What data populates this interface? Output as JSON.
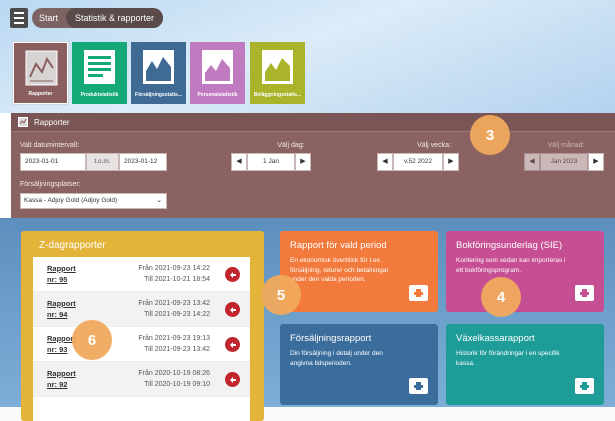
{
  "topbar": {
    "start": "Start",
    "current": "Statistik & rapporter"
  },
  "tiles": [
    {
      "label": "Rapporter",
      "color": "#8a5e5e"
    },
    {
      "label": "Produktstatistik",
      "color": "#15a878"
    },
    {
      "label": "Försäljningsstatis...",
      "color": "#3e6a94"
    },
    {
      "label": "Personalstatistik",
      "color": "#c07ac0"
    },
    {
      "label": "Beläggningsstatis...",
      "color": "#aab42a"
    }
  ],
  "panel": {
    "title": "Rapporter",
    "date_interval_label": "Valt datumintervall:",
    "date_from": "2023-01-01",
    "tom": "t.o.m.",
    "date_to": "2023-01-12",
    "day_label": "Välj dag:",
    "day_value": "1 Jan",
    "week_label": "Välj vecka:",
    "week_value": "v.52 2022",
    "month_label": "Välj månad:",
    "month_value": "Jan 2023",
    "sales_points_label": "Försäljningsplatser:",
    "sales_point_value": "Kassa - Adjoy Gold (Adjoy Gold)"
  },
  "zdag": {
    "title": "Z-dagrapporter",
    "rows": [
      {
        "name": "Rapport",
        "nr": "nr: 95",
        "from": "Från 2021-09-23 14:22",
        "to": "Till 2021-10-21 18:54"
      },
      {
        "name": "Rapport",
        "nr": "nr: 94",
        "from": "Från 2021-09-23 13:42",
        "to": "Till 2021-09-23 14:22"
      },
      {
        "name": "Rapport",
        "nr": "nr: 93",
        "from": "Från 2021-09-23 19:13",
        "to": "Till 2021-09-23 13:42"
      },
      {
        "name": "Rapport",
        "nr": "nr: 92",
        "from": "Från 2020-10-19 08:26",
        "to": "Till 2020-10-19 09:10"
      }
    ]
  },
  "cards": [
    {
      "title": "Rapport för vald period",
      "desc": "En ekonomisk överblick för t.ex. försäljning, returer och betalningar under den valda perioden.",
      "color": "#f27a3c"
    },
    {
      "title": "Bokföringsunderlag (SIE)",
      "desc": "Kontering som sedan kan importeras i ett bokföringsprogram.",
      "color": "#c64f93"
    },
    {
      "title": "Försäljningsrapport",
      "desc": "Din försäljning i detalj under den angivna tidsperioden.",
      "color": "#3b6d9c"
    },
    {
      "title": "Växelkassarapport",
      "desc": "Historik för förändringar i en specifik kassa.",
      "color": "#1e9c98"
    }
  ],
  "markers": [
    "3",
    "4",
    "5",
    "6"
  ],
  "colors": {
    "panel": "#8a6262",
    "zdag": "#e4b43a",
    "marker": "#f1a95c",
    "report_icon": "#c0262c"
  }
}
